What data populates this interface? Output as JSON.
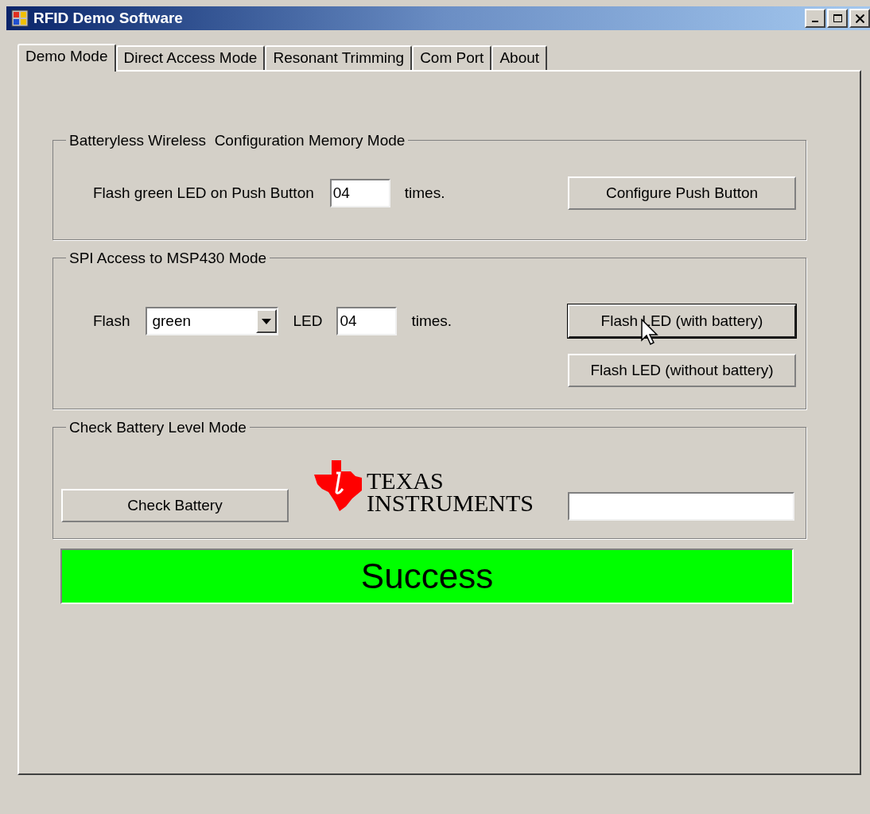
{
  "window": {
    "title": "RFID Demo Software"
  },
  "tabs": [
    {
      "label": "Demo Mode",
      "selected": true
    },
    {
      "label": "Direct Access Mode",
      "selected": false
    },
    {
      "label": "Resonant Trimming",
      "selected": false
    },
    {
      "label": "Com Port",
      "selected": false
    },
    {
      "label": "About",
      "selected": false
    }
  ],
  "config_group": {
    "title": "Batteryless Wireless  Configuration Memory Mode",
    "label": "Flash green LED on Push Button",
    "count": "04",
    "suffix": "times.",
    "button": "Configure Push Button"
  },
  "spi_group": {
    "title": "SPI Access to MSP430 Mode",
    "flash_label": "Flash",
    "color_select": "green",
    "led_label": "LED",
    "count": "04",
    "suffix": "times.",
    "buttons": [
      {
        "label": "Flash LED (with battery)",
        "focused": true
      },
      {
        "label": "Flash LED (without battery)",
        "focused": false
      }
    ]
  },
  "battery_group": {
    "title": "Check Battery Level Mode",
    "button": "Check Battery",
    "logo": [
      "TEXAS",
      "INSTRUMENTS"
    ]
  },
  "status": {
    "text": "Success",
    "color": "#00ff00"
  }
}
